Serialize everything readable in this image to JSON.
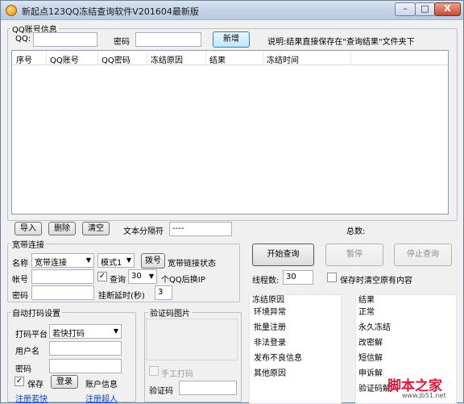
{
  "window": {
    "title": "新起点123QQ冻结查询软件V201604最新版",
    "minimize": "–",
    "maximize": "□",
    "close": "X"
  },
  "account": {
    "group_title": "QQ账号信息",
    "qq_label": "QQ:",
    "qq_value": "",
    "pwd_label": "密码",
    "pwd_value": "",
    "add_button": "新增",
    "note": "说明:结果直接保存在\"查询结果\"文件夹下"
  },
  "grid": {
    "columns": [
      "序号",
      "QQ账号",
      "QQ密码",
      "冻结原因",
      "结果",
      "冻结时间"
    ],
    "rows": []
  },
  "toolbar": {
    "import": "导入",
    "delete": "删除",
    "clear": "清空",
    "separator_label": "文本分隔符",
    "separator_value": "----",
    "total_label": "总数:"
  },
  "broadband": {
    "group_title": "宽带连接",
    "name_label": "名称",
    "name_value": "宽带连接",
    "mode_value": "模式1",
    "dial_button": "拨号",
    "status_label": "宽带链接状态",
    "account_label": "帐号",
    "query_checked": true,
    "query_label": "查询",
    "query_count": "30",
    "ip_suffix": "个QQ后换IP",
    "pwd_label": "密码",
    "delay_label": "挂断延时(秒)",
    "delay_value": "3"
  },
  "actions": {
    "start": "开始查询",
    "pause": "暂停",
    "stop": "停止查询",
    "threads_label": "线程数:",
    "threads_value": "30",
    "keep_checked": false,
    "keep_label": "保存时清空原有内容"
  },
  "captcha": {
    "group_title": "自动打码设置",
    "platform_label": "打码平台",
    "platform_value": "若快打码",
    "user_label": "用户名",
    "pwd_label": "密码",
    "save_checked": true,
    "save_label": "保存",
    "login_button": "登录",
    "account_info": "账户信息",
    "register_ruokuai": "注册若快",
    "register_super": "注册超人",
    "image_group_title": "验证码图片",
    "manual_label": "手工打码",
    "manual_checked": false,
    "code_label": "验证码"
  },
  "freeze_reasons": {
    "title": "冻结原因",
    "items": [
      "环境异常",
      "批量注册",
      "非法登录",
      "发布不良信息",
      "其他原因"
    ]
  },
  "results": {
    "title": "结果",
    "items": [
      "正常",
      "永久冻结",
      "改密解",
      "短信解",
      "申诉解",
      "验证码解"
    ]
  },
  "watermark": {
    "main": "脚本之家",
    "sub": "www.jb51.net"
  }
}
